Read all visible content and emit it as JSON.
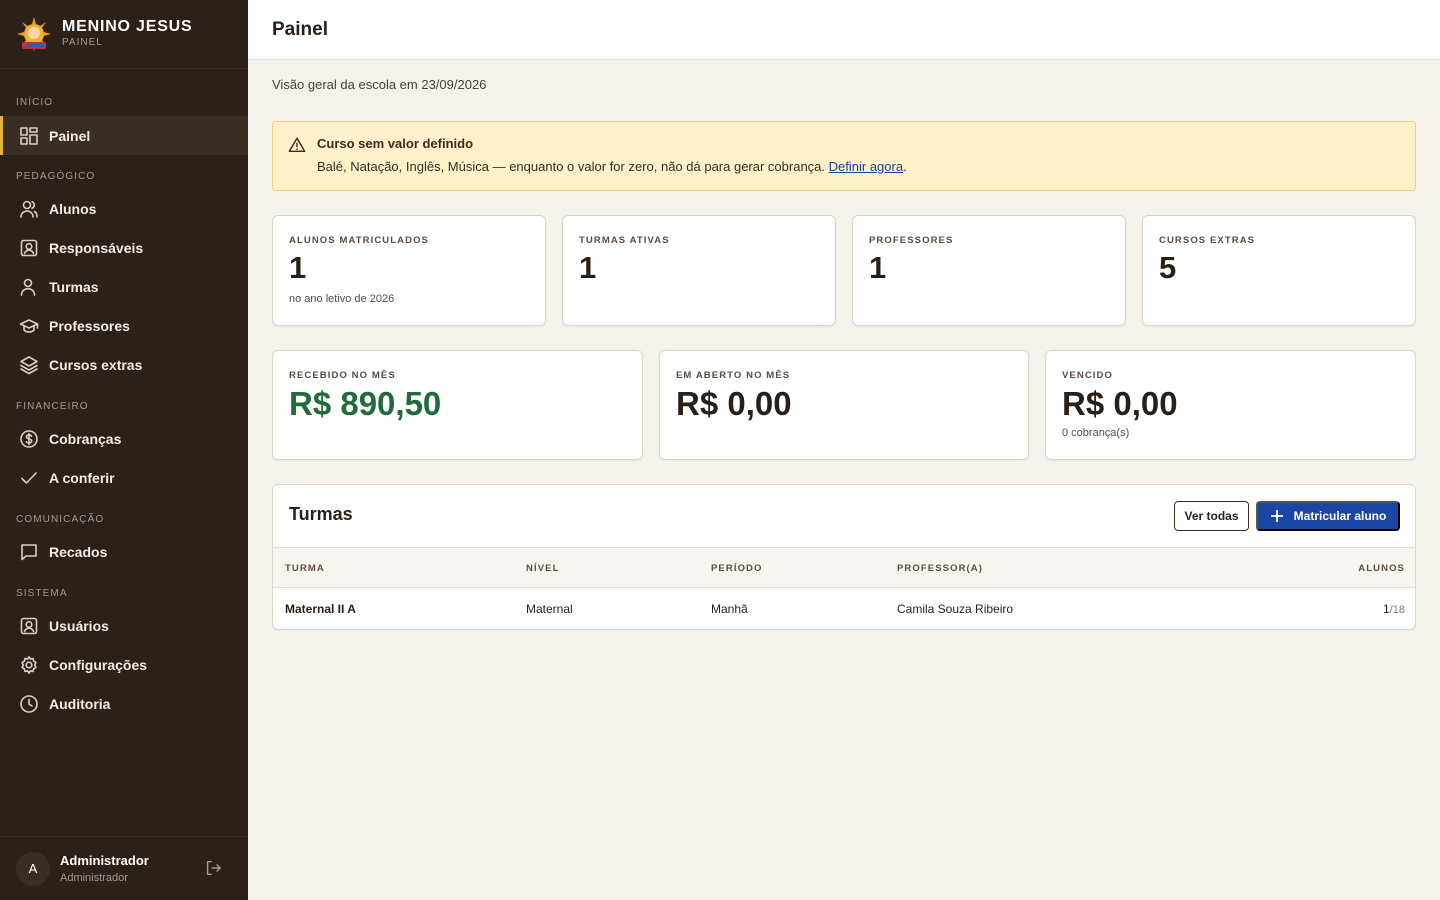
{
  "brand": {
    "name": "MENINO JESUS",
    "subtitle": "PAINEL"
  },
  "sidebar": {
    "sections": [
      {
        "title": "INÍCIO"
      },
      {
        "title": "PEDAGÓGICO"
      },
      {
        "title": "FINANCEIRO"
      },
      {
        "title": "COMUNICAÇÃO"
      },
      {
        "title": "SISTEMA"
      }
    ],
    "items": [
      {
        "label": "Painel",
        "icon": "dashboard-icon",
        "active": true
      },
      {
        "label": "Alunos",
        "icon": "users-icon"
      },
      {
        "label": "Responsáveis",
        "icon": "contact-icon"
      },
      {
        "label": "Turmas",
        "icon": "user-icon"
      },
      {
        "label": "Professores",
        "icon": "graduation-cap-icon"
      },
      {
        "label": "Cursos extras",
        "icon": "layers-icon"
      },
      {
        "label": "Cobranças",
        "icon": "dollar-circle-icon"
      },
      {
        "label": "A conferir",
        "icon": "check-icon"
      },
      {
        "label": "Recados",
        "icon": "message-icon"
      },
      {
        "label": "Usuários",
        "icon": "contact-icon"
      },
      {
        "label": "Configurações",
        "icon": "gear-icon"
      },
      {
        "label": "Auditoria",
        "icon": "clock-icon"
      }
    ]
  },
  "user": {
    "initial": "A",
    "name": "Administrador",
    "role": "Administrador"
  },
  "header": {
    "title": "Painel"
  },
  "main": {
    "subtitle": "Visão geral da escola em 23/09/2026",
    "alert": {
      "title": "Curso sem valor definido",
      "message": "Balé, Natação, Inglês, Música — enquanto o valor for zero, não dá para gerar cobrança. ",
      "link": "Definir agora",
      "suffix": "."
    },
    "stats": [
      {
        "label": "ALUNOS MATRICULADOS",
        "value": "1",
        "note": "no ano letivo de 2026"
      },
      {
        "label": "TURMAS ATIVAS",
        "value": "1",
        "note": ""
      },
      {
        "label": "PROFESSORES",
        "value": "1",
        "note": ""
      },
      {
        "label": "CURSOS EXTRAS",
        "value": "5",
        "note": ""
      }
    ],
    "finance": [
      {
        "label": "RECEBIDO NO MÊS",
        "value": "R$ 890,50",
        "note": ""
      },
      {
        "label": "EM ABERTO NO MÊS",
        "value": "R$ 0,00",
        "note": ""
      },
      {
        "label": "VENCIDO",
        "value": "R$ 0,00",
        "note": "0 cobrança(s)"
      }
    ],
    "turmas": {
      "title": "Turmas",
      "view_all": "Ver todas",
      "enroll": "Matricular aluno",
      "columns": [
        "TURMA",
        "NÍVEL",
        "PERÍODO",
        "PROFESSOR(A)",
        "ALUNOS"
      ],
      "rows": [
        {
          "turma": "Maternal II A",
          "nivel": "Maternal",
          "periodo": "Manhã",
          "professor": "Camila Souza Ribeiro",
          "alunos": "1",
          "capacidade": "/18"
        }
      ]
    }
  },
  "colors": {
    "sidebar_bg": "#2c2118",
    "accent": "#e2b23c",
    "primary": "#1c46a6",
    "positive": "#1f6b3a",
    "alert_bg": "#fdf1c9"
  }
}
